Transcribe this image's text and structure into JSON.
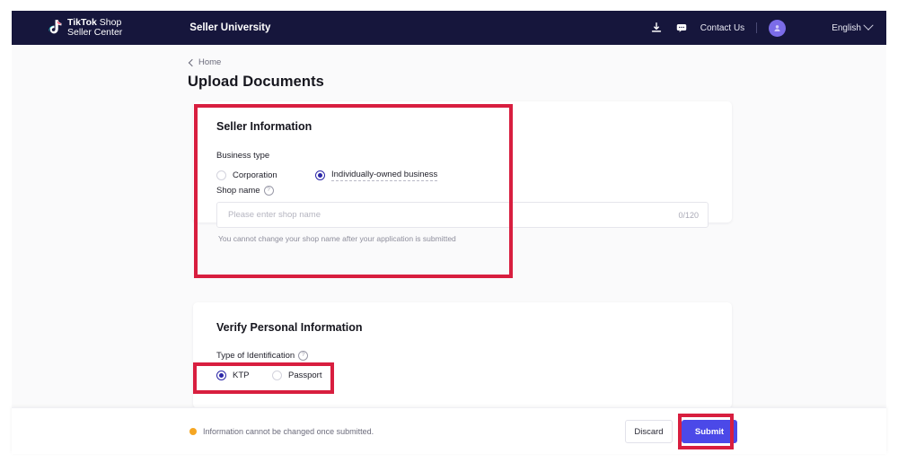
{
  "navbar": {
    "brand": {
      "line1_bold": "TikTok",
      "line1_rest": " Shop",
      "line2": "Seller Center",
      "icon": "tiktok-note-icon"
    },
    "seller_university": "Seller University",
    "download_icon": "download-icon",
    "chat_icon": "chat-bubble-icon",
    "contact_us": "Contact Us",
    "avatar_icon": "user-avatar-icon",
    "language": "English",
    "chevron_icon": "chevron-down-icon"
  },
  "breadcrumb": {
    "back_icon": "chevron-left-icon",
    "label": "Home"
  },
  "page_title": "Upload Documents",
  "seller_information": {
    "title": "Seller Information",
    "business_type_label": "Business type",
    "options": [
      {
        "label": "Corporation",
        "checked": false
      },
      {
        "label": "Individually-owned business",
        "checked": true
      }
    ],
    "shop_name_label": "Shop name",
    "help_icon": "question-mark-icon",
    "shop_name_value": "",
    "shop_name_placeholder": "Please enter shop name",
    "counter": "0/120",
    "hint": "You cannot change your shop name after your application is submitted"
  },
  "verify_personal_information": {
    "title": "Verify Personal Information",
    "id_type_label": "Type of Identification",
    "help_icon": "question-mark-icon",
    "options": [
      {
        "label": "KTP",
        "checked": true
      },
      {
        "label": "Passport",
        "checked": false
      }
    ]
  },
  "footer": {
    "warning_icon": "warning-dot-icon",
    "note": "Information cannot be changed once submitted.",
    "discard_label": "Discard",
    "submit_label": "Submit"
  },
  "colors": {
    "nav_bg": "#16163c",
    "accent": "#4b49e8",
    "radio_checked": "#2c27a8",
    "annotation": "#d81e3f",
    "warning": "#f5a623",
    "page_bg": "#fafafb"
  }
}
